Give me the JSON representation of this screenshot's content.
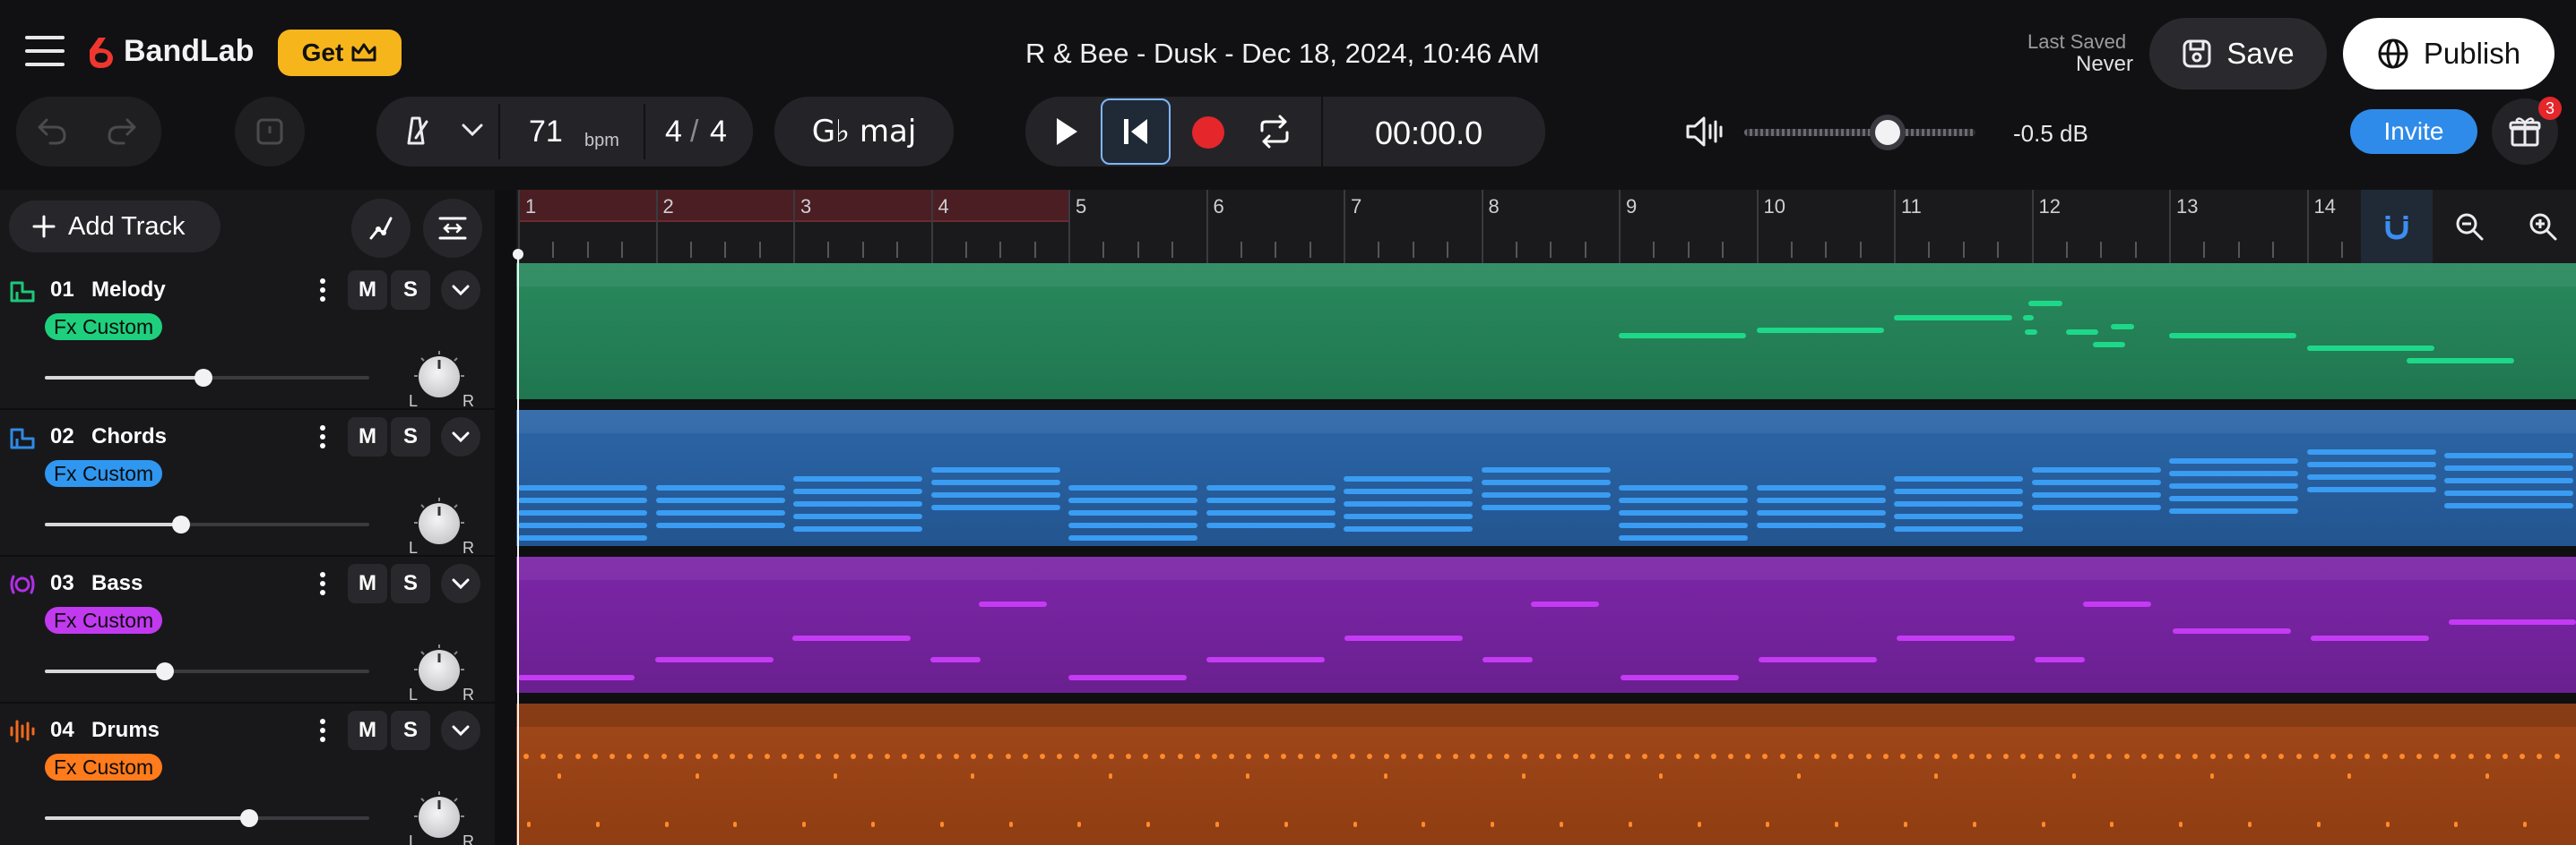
{
  "app": {
    "brand": "BandLab",
    "get_label": "Get",
    "project_title": "R & Bee - Dusk - Dec 18, 2024, 10:46 AM",
    "last_saved_label": "Last Saved",
    "last_saved_value": "Never",
    "save_label": "Save",
    "publish_label": "Publish"
  },
  "transport": {
    "tempo": "71",
    "tempo_unit": "bpm",
    "time_sig_num": "4",
    "time_sig_sep": "/",
    "time_sig_den": "4",
    "key": "G♭ maj",
    "time": "00:00.0",
    "volume_db": "-0.5 dB",
    "volume_level": 0.62,
    "invite_label": "Invite",
    "gift_count": "3"
  },
  "tracks_panel": {
    "add_track_label": "Add Track",
    "tracks": [
      {
        "number": "01",
        "name": "Melody",
        "fx": "Fx Custom",
        "color": "#1ec77a",
        "fx_color": "#1ed07d",
        "volume": 0.49,
        "mute": "M",
        "solo": "S",
        "pan_l": "L",
        "pan_r": "R",
        "icon": "piano-icon"
      },
      {
        "number": "02",
        "name": "Chords",
        "fx": "Fx Custom",
        "color": "#2f8ae6",
        "fx_color": "#2f97f0",
        "volume": 0.42,
        "mute": "M",
        "solo": "S",
        "pan_l": "L",
        "pan_r": "R",
        "icon": "piano-icon"
      },
      {
        "number": "03",
        "name": "Bass",
        "fx": "Fx Custom",
        "color": "#b12fe6",
        "fx_color": "#c13aef",
        "volume": 0.37,
        "mute": "M",
        "solo": "S",
        "pan_l": "L",
        "pan_r": "R",
        "icon": "synth-icon"
      },
      {
        "number": "04",
        "name": "Drums",
        "fx": "Fx Custom",
        "color": "#f26a1b",
        "fx_color": "#ff7b1c",
        "volume": 0.63,
        "mute": "M",
        "solo": "S",
        "pan_l": "L",
        "pan_r": "R",
        "icon": "waveform-icon"
      }
    ]
  },
  "ruler": {
    "bars": [
      "1",
      "2",
      "3",
      "4",
      "5",
      "6",
      "7",
      "8",
      "9",
      "10",
      "11",
      "12",
      "13",
      "14"
    ],
    "loop_region": "1-4"
  },
  "colors": {
    "background": "#0f0f11",
    "melody_lane": "#1f7a52",
    "chords_lane": "#23558f",
    "bass_lane": "#6a2090",
    "drums_lane": "#8f3d12",
    "record": "#e5262b",
    "invite": "#2f8be9",
    "get": "#f7b51c"
  }
}
